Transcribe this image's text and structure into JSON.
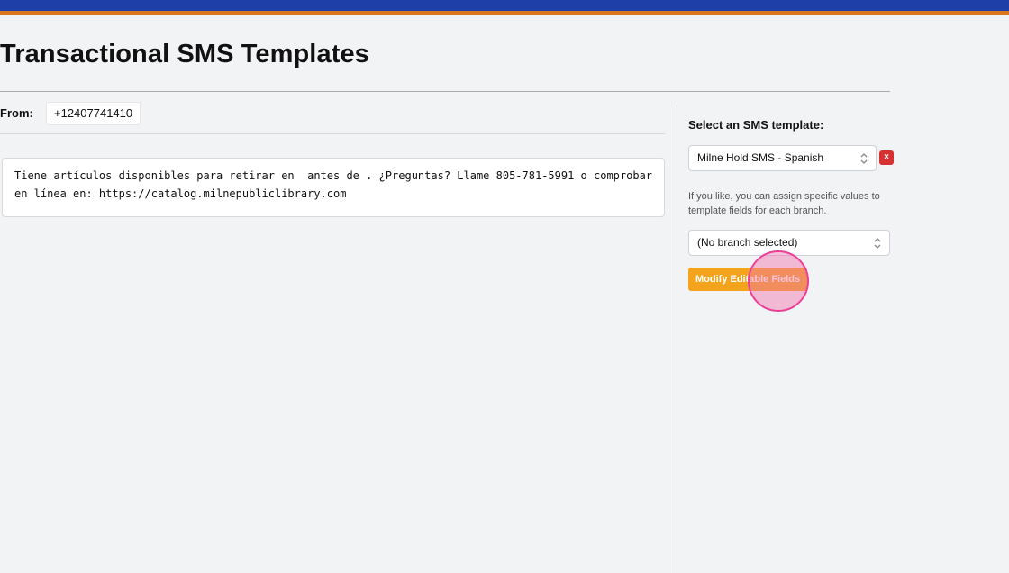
{
  "header": {
    "title": "Transactional SMS Templates"
  },
  "from": {
    "label": "From:",
    "number": "+12407741410"
  },
  "message": {
    "text": "Tiene artículos disponibles para retirar en  antes de . ¿Preguntas? Llame 805-781-5991 o comprobar en línea en: https://catalog.milnepubliclibrary.com"
  },
  "sidebar": {
    "heading": "Select an SMS template:",
    "template_select_value": "Milne Hold SMS - Spanish",
    "delete_symbol": "×",
    "help_text": "If you like, you can assign specific values to template fields for each branch.",
    "branch_select_value": "(No branch selected)",
    "modify_button_label": "Modify Editable Fields"
  },
  "colors": {
    "top_bar_primary": "#1f3fa8",
    "top_bar_accent": "#d9771f",
    "modify_button": "#f3a41c",
    "delete_button": "#d63031",
    "click_indicator": "#ea3f97"
  },
  "icons": {
    "select_chevron": "chevron-up-down-icon",
    "delete": "close-icon"
  }
}
